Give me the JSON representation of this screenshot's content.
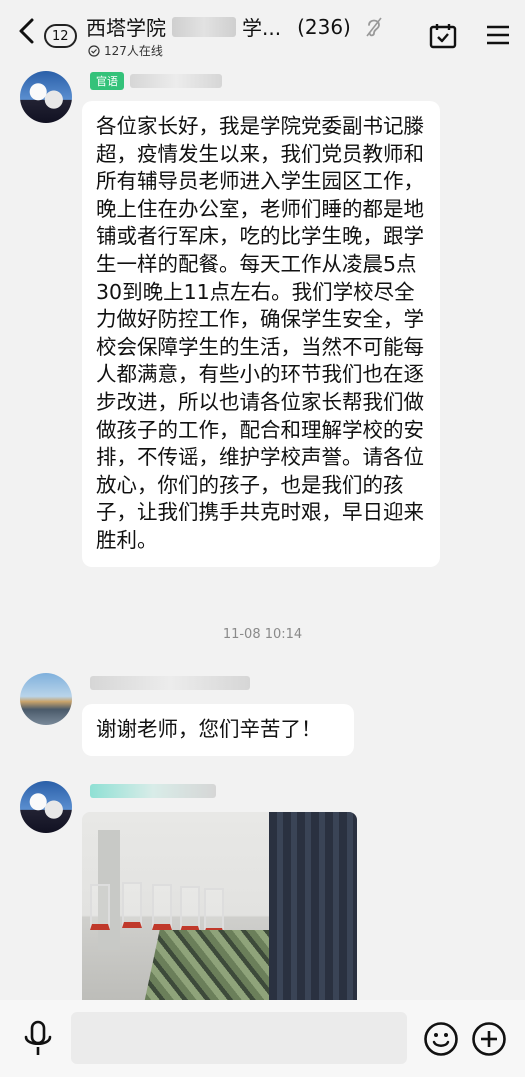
{
  "header": {
    "unread_count": "12",
    "title_prefix": "西塔学院",
    "title_suffix": "学...",
    "member_count": "(236)",
    "online_text": "127人在线"
  },
  "messages": [
    {
      "sender_tag": "官语",
      "text": "各位家长好，我是学院党委副书记滕超，疫情发生以来，我们党员教师和所有辅导员老师进入学生园区工作，晚上住在办公室，老师们睡的都是地铺或者行军床，吃的比学生晚，跟学生一样的配餐。每天工作从凌晨5点30到晚上11点左右。我们学校尽全力做好防控工作，确保学生安全，学校会保障学生的生活，当然不可能每人都满意，有些小的环节我们也在逐步改进，所以也请各位家长帮我们做做孩子的工作，配合和理解学校的安排，不传谣，维护学校声誉。请各位放心，你们的孩子，也是我们的孩子，让我们携手共克时艰，早日迎来胜利。"
    },
    {
      "text": "谢谢老师，您们辛苦了！"
    }
  ],
  "timestamp": "11-08 10:14",
  "icons": {
    "back": "chevron-left-icon",
    "calendar": "calendar-check-icon",
    "menu": "menu-icon",
    "mic": "microphone-icon",
    "emoji": "emoji-icon",
    "plus": "plus-circle-icon"
  },
  "colors": {
    "background": "#f2f2f2",
    "bubble": "#ffffff",
    "role_tag": "#34c27a"
  }
}
